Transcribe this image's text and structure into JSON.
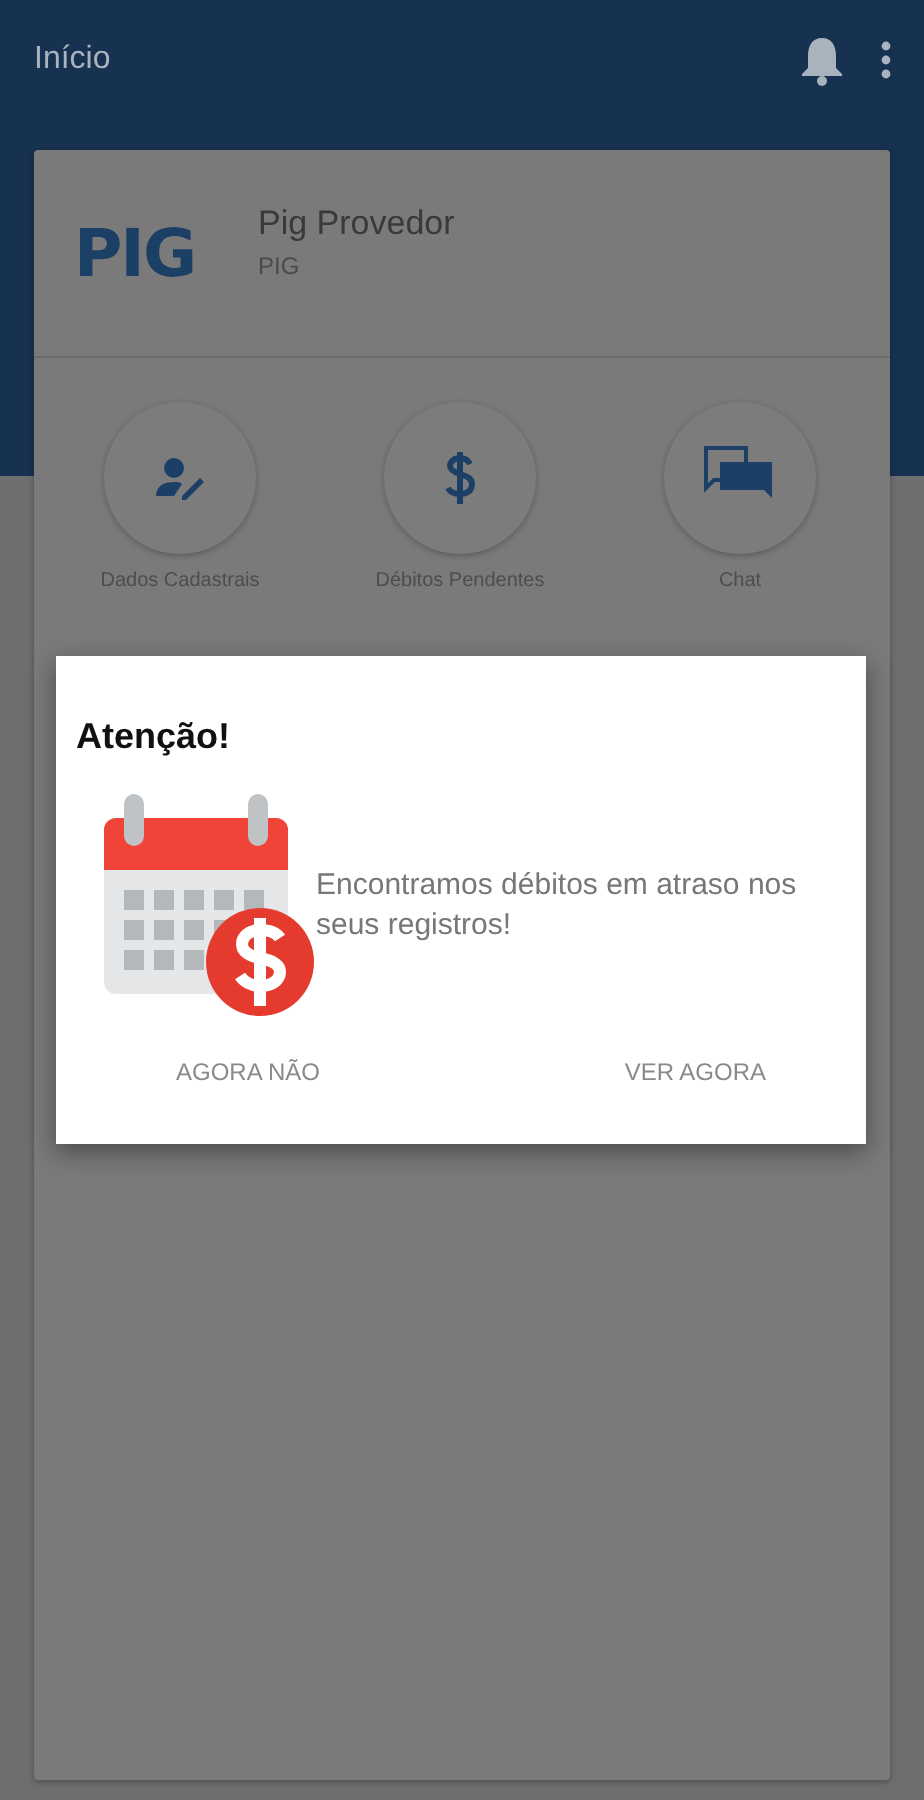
{
  "app_bar": {
    "title": "Início"
  },
  "provider": {
    "logo": "PIG",
    "name": "Pig Provedor",
    "code": "PIG"
  },
  "shortcuts": [
    {
      "kind": "profile",
      "label": "Dados Cadastrais"
    },
    {
      "kind": "money",
      "label": "Débitos Pendentes"
    },
    {
      "kind": "chat",
      "label": "Chat"
    }
  ],
  "dialog": {
    "title": "Atenção!",
    "message": "Encontramos débitos em atraso nos seus registros!",
    "buttons": [
      "AGORA NÃO",
      "VER AGORA"
    ]
  }
}
